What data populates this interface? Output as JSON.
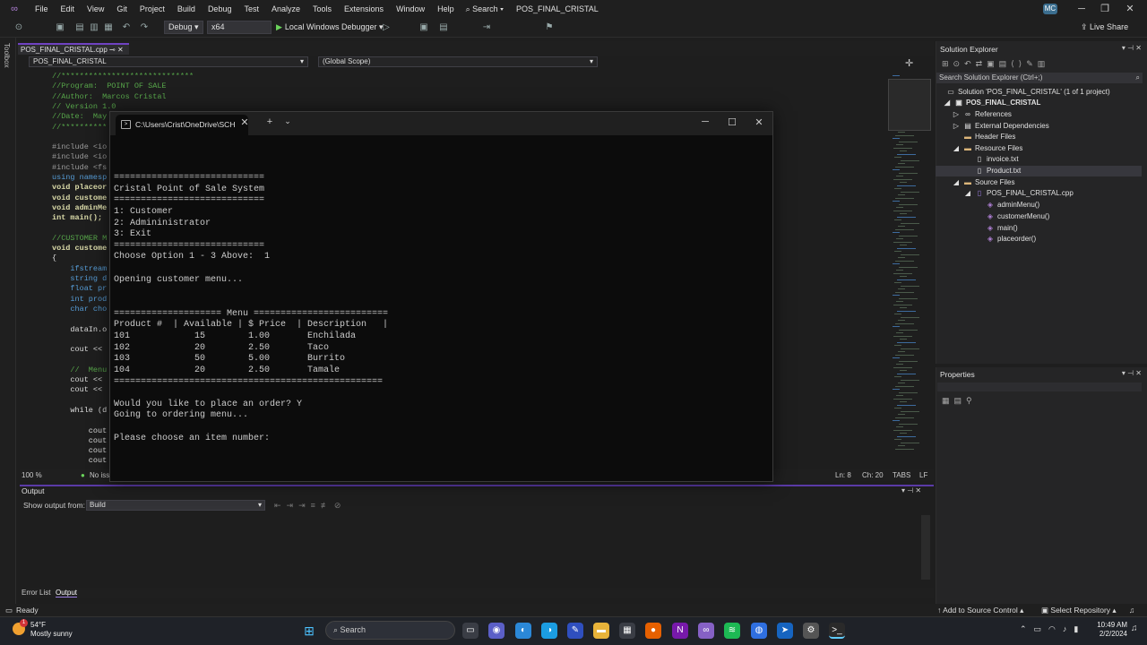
{
  "menubar": {
    "items": [
      "File",
      "Edit",
      "View",
      "Git",
      "Project",
      "Build",
      "Debug",
      "Test",
      "Analyze",
      "Tools",
      "Extensions",
      "Window",
      "Help"
    ],
    "search": "Search",
    "project_title": "POS_FINAL_CRISTAL",
    "avatar": "MC"
  },
  "toolbar": {
    "config": "Debug",
    "platform": "x64",
    "run_label": "Local Windows Debugger",
    "live_share": "Live Share"
  },
  "toolbox_label": "Toolbox",
  "editor": {
    "tab": "POS_FINAL_CRISTAL.cpp",
    "nav_project": "POS_FINAL_CRISTAL",
    "nav_scope": "(Global Scope)",
    "lines": [
      {
        "t": "//*****************************",
        "c": "cmt"
      },
      {
        "t": "//Program:  POINT OF SALE",
        "c": "cmt"
      },
      {
        "t": "//Author:  Marcos Cristal",
        "c": "cmt"
      },
      {
        "t": "// Version 1.0",
        "c": "cmt"
      },
      {
        "t": "//Date:  May",
        "c": "cmt"
      },
      {
        "t": "//**********",
        "c": "cmt"
      },
      {
        "t": "",
        "c": "tx"
      },
      {
        "t": "#include <io",
        "c": "pp"
      },
      {
        "t": "#include <io",
        "c": "pp"
      },
      {
        "t": "#include <fs",
        "c": "pp"
      },
      {
        "t": "using namesp",
        "c": "kw"
      },
      {
        "t": "void placeor",
        "c": "fn"
      },
      {
        "t": "void custome",
        "c": "fn"
      },
      {
        "t": "void adminMe",
        "c": "fn"
      },
      {
        "t": "int main();",
        "c": "fn"
      },
      {
        "t": "",
        "c": "tx"
      },
      {
        "t": "//CUSTOMER M",
        "c": "cmt"
      },
      {
        "t": "void custome",
        "c": "fn"
      },
      {
        "t": "{",
        "c": "tx"
      },
      {
        "t": "    ifstream",
        "c": "kw"
      },
      {
        "t": "    string d",
        "c": "kw"
      },
      {
        "t": "    float pr",
        "c": "kw"
      },
      {
        "t": "    int prod",
        "c": "kw"
      },
      {
        "t": "    char cho",
        "c": "kw"
      },
      {
        "t": "",
        "c": "tx"
      },
      {
        "t": "    dataIn.o",
        "c": "tx"
      },
      {
        "t": "",
        "c": "tx"
      },
      {
        "t": "    cout << ",
        "c": "tx"
      },
      {
        "t": "",
        "c": "tx"
      },
      {
        "t": "    //  Menu",
        "c": "cmt"
      },
      {
        "t": "    cout << ",
        "c": "tx"
      },
      {
        "t": "    cout << ",
        "c": "tx"
      },
      {
        "t": "",
        "c": "tx"
      },
      {
        "t": "    while (d",
        "c": "tx"
      },
      {
        "t": "",
        "c": "tx"
      },
      {
        "t": "        cout",
        "c": "tx"
      },
      {
        "t": "        cout",
        "c": "tx"
      },
      {
        "t": "        cout",
        "c": "tx"
      },
      {
        "t": "        cout",
        "c": "tx"
      }
    ],
    "status": {
      "zoom": "100 %",
      "issues": "No iss",
      "ln": "Ln: 8",
      "ch": "Ch: 20",
      "tabs": "TABS",
      "eol": "LF"
    }
  },
  "terminal": {
    "tab_title": "C:\\Users\\Crist\\OneDrive\\SCH",
    "lines": [
      "============================",
      "Cristal Point of Sale System",
      "============================",
      "1: Customer",
      "2: Admininistrator",
      "3: Exit",
      "============================",
      "Choose Option 1 - 3 Above:  1",
      "",
      "Opening customer menu...",
      "",
      "",
      "==================== Menu =========================",
      "Product #  | Available | $ Price  | Description   |",
      "101            15        1.00       Enchilada",
      "102            20        2.50       Taco",
      "103            50        5.00       Burrito",
      "104            20        2.50       Tamale",
      "==================================================",
      "",
      "Would you like to place an order? Y",
      "Going to ordering menu...",
      "",
      "Please choose an item number:"
    ]
  },
  "output": {
    "title": "Output",
    "show_from_label": "Show output from:",
    "show_from_value": "Build",
    "tabs": [
      "Error List",
      "Output"
    ]
  },
  "solution_explorer": {
    "title": "Solution Explorer",
    "search_placeholder": "Search Solution Explorer (Ctrl+;)",
    "solution": "Solution 'POS_FINAL_CRISTAL' (1 of 1 project)",
    "project": "POS_FINAL_CRISTAL",
    "references": "References",
    "external": "External Dependencies",
    "header": "Header Files",
    "resource": "Resource Files",
    "res_files": [
      "invoice.txt",
      "Product.txt"
    ],
    "source": "Source Files",
    "cpp": "POS_FINAL_CRISTAL.cpp",
    "functions": [
      "adminMenu()",
      "customerMenu()",
      "main()",
      "placeorder()"
    ]
  },
  "properties": {
    "title": "Properties"
  },
  "statusbar": {
    "ready": "Ready",
    "source_control": "Add to Source Control",
    "repo": "Select Repository"
  },
  "taskbar": {
    "temp": "54°F",
    "weather": "Mostly sunny",
    "search": "Search",
    "time": "10:49 AM",
    "date": "2/2/2024",
    "notif": "1"
  }
}
